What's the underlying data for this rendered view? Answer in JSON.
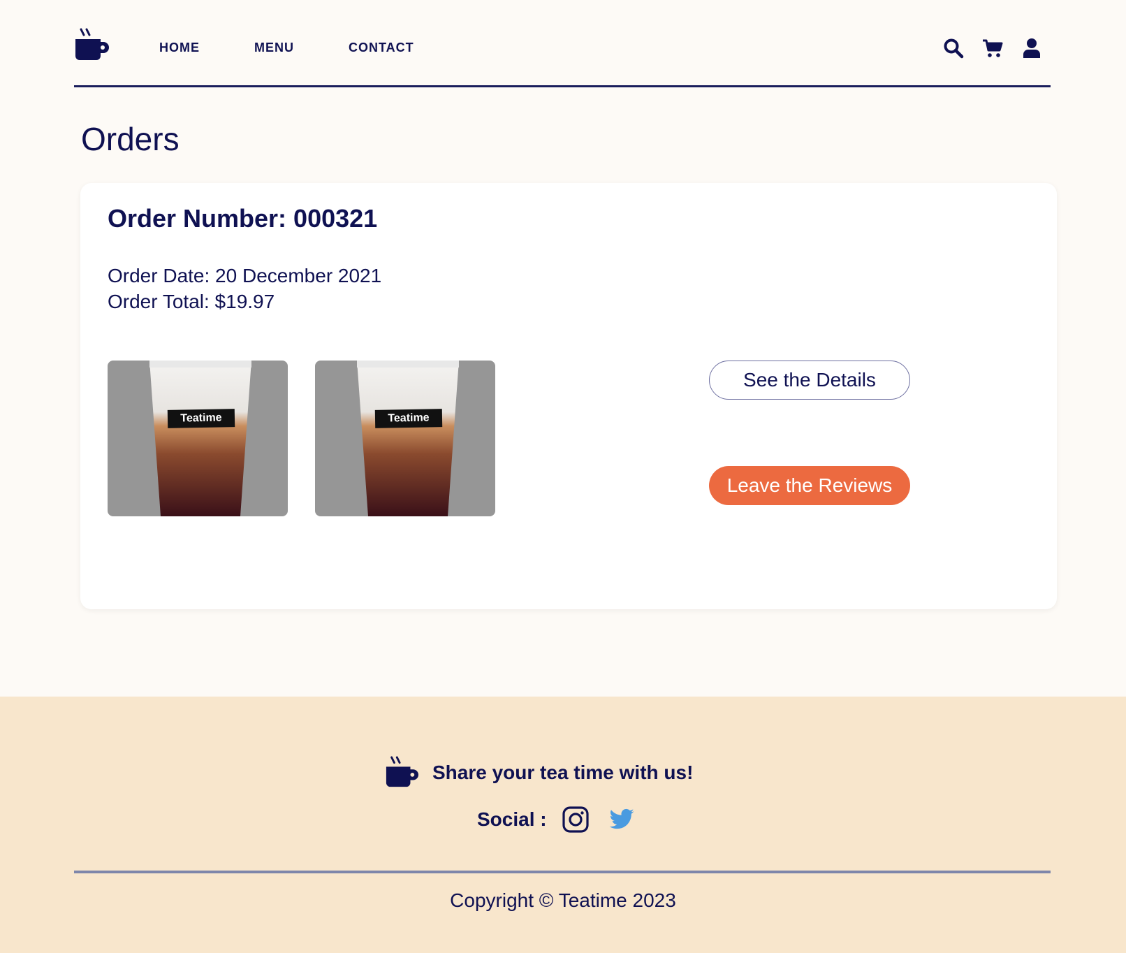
{
  "nav": {
    "home": "HOME",
    "menu": "MENU",
    "contact": "CONTACT"
  },
  "icons": {
    "logo": "coffee-cup-icon",
    "search": "search-icon",
    "cart": "cart-icon",
    "user": "user-icon",
    "instagram": "instagram-icon",
    "twitter": "twitter-icon"
  },
  "page": {
    "title": "Orders"
  },
  "order": {
    "number_label": "Order Number: 000321",
    "date_label": "Order Date: 20 December 2021",
    "total_label": "Order Total: $19.97",
    "items": [
      {
        "label": "Teatime"
      },
      {
        "label": "Teatime"
      }
    ],
    "details_button": "See the Details",
    "review_button": "Leave the Reviews"
  },
  "footer": {
    "share_text": "Share your tea time with us!",
    "social_label": "Social :",
    "copyright": "Copyright © Teatime 2023"
  },
  "colors": {
    "primary": "#0f1152",
    "accent": "#ec6a40",
    "background": "#fdfaf6",
    "footer_bg": "#f8e6cc",
    "twitter": "#4a9be0"
  }
}
